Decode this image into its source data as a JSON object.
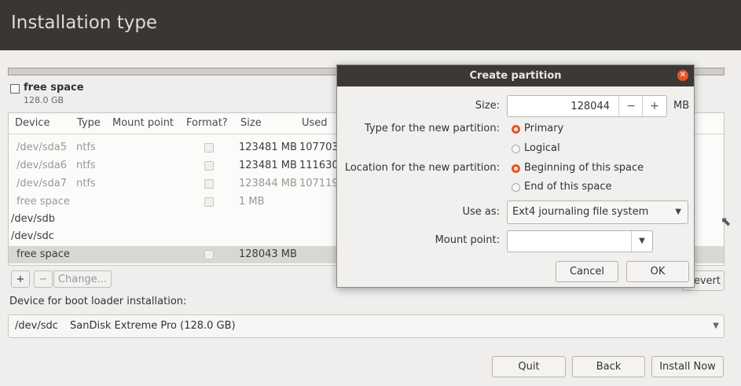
{
  "window": {
    "title": "Installation type"
  },
  "disk": {
    "label": "free space",
    "size": "128.0 GB"
  },
  "table": {
    "headers": [
      "Device",
      "Type",
      "Mount point",
      "Format?",
      "Size",
      "Used"
    ],
    "rows": [
      {
        "device": "/dev/sda5",
        "type": "ntfs",
        "mount": "",
        "size": "123481 MB",
        "used": "107703"
      },
      {
        "device": "/dev/sda6",
        "type": "ntfs",
        "mount": "",
        "size": "123481 MB",
        "used": "111630"
      },
      {
        "device": "/dev/sda7",
        "type": "ntfs",
        "mount": "",
        "size": "123844 MB",
        "used": "107119"
      },
      {
        "device": "free space",
        "type": "",
        "mount": "",
        "size": "1 MB",
        "used": ""
      },
      {
        "device": "/dev/sdb",
        "type": "",
        "mount": "",
        "size": "",
        "used": ""
      },
      {
        "device": "/dev/sdc",
        "type": "",
        "mount": "",
        "size": "",
        "used": ""
      },
      {
        "device": "free space",
        "type": "",
        "mount": "",
        "size": "128043 MB",
        "used": ""
      }
    ]
  },
  "toolbar": {
    "add": "+",
    "remove": "−",
    "change": "Change...",
    "revert": "evert"
  },
  "boot": {
    "label": "Device for boot loader installation:",
    "device": "/dev/sdc",
    "description": "SanDisk Extreme Pro (128.0 GB)"
  },
  "buttons": {
    "quit": "Quit",
    "back": "Back",
    "install": "Install Now"
  },
  "dialog": {
    "title": "Create partition",
    "size_label": "Size:",
    "size_value": "128044",
    "size_minus": "−",
    "size_plus": "+",
    "size_unit": "MB",
    "type_label": "Type for the new partition:",
    "type_primary": "Primary",
    "type_logical": "Logical",
    "location_label": "Location for the new partition:",
    "location_begin": "Beginning of this space",
    "location_end": "End of this space",
    "use_as_label": "Use as:",
    "use_as_value": "Ext4 journaling file system",
    "mount_label": "Mount point:",
    "mount_value": "",
    "cancel": "Cancel",
    "ok": "OK"
  },
  "accent_color": "#e95420"
}
